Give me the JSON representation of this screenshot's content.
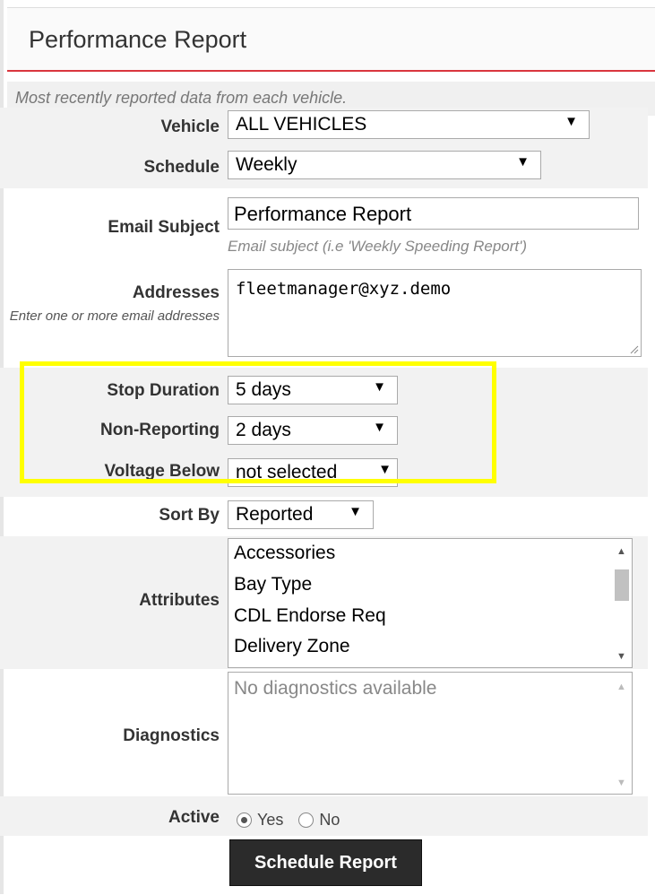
{
  "header": {
    "title": "Performance Report",
    "accent_color": "#d9363e"
  },
  "subtitle": "Most recently reported data from each vehicle.",
  "form": {
    "vehicle": {
      "label": "Vehicle",
      "value": "ALL VEHICLES"
    },
    "schedule": {
      "label": "Schedule",
      "value": "Weekly"
    },
    "email_subject": {
      "label": "Email Subject",
      "value": "Performance Report",
      "hint": "Email subject (i.e 'Weekly Speeding Report')"
    },
    "addresses": {
      "label": "Addresses",
      "sublabel": "Enter one or more email addresses",
      "value": "fleetmanager@xyz.demo"
    },
    "stop_duration": {
      "label": "Stop Duration",
      "value": "5 days"
    },
    "non_reporting": {
      "label": "Non-Reporting",
      "value": "2 days"
    },
    "voltage_below": {
      "label": "Voltage Below",
      "value": "not selected"
    },
    "sort_by": {
      "label": "Sort By",
      "value": "Reported"
    },
    "attributes": {
      "label": "Attributes",
      "options": [
        "Accessories",
        "Bay Type",
        "CDL Endorse Req",
        "Delivery Zone"
      ]
    },
    "diagnostics": {
      "label": "Diagnostics",
      "placeholder": "No diagnostics available"
    },
    "active": {
      "label": "Active",
      "options": [
        "Yes",
        "No"
      ],
      "selected": "Yes"
    }
  },
  "submit_label": "Schedule Report",
  "highlight_color": "#ffff00"
}
